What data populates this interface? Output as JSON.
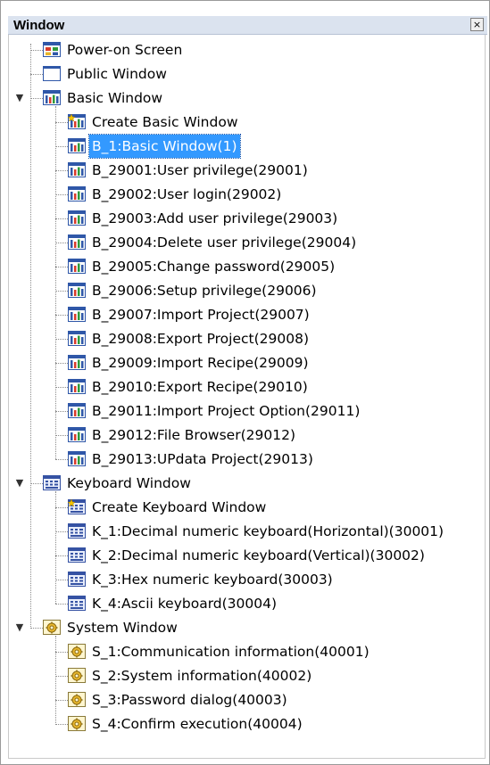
{
  "panel": {
    "title": "Window",
    "close_glyph": "×"
  },
  "tree": {
    "power_on": {
      "label": "Power-on Screen",
      "icon": "power-on-screen-icon"
    },
    "public": {
      "label": "Public Window",
      "icon": "window-icon"
    },
    "basic": {
      "label": "Basic Window",
      "expanded": true,
      "icon": "basic-window-icon",
      "items": [
        {
          "label": "Create Basic Window"
        },
        {
          "label": "B_1:Basic Window(1)",
          "selected": true
        },
        {
          "label": "B_29001:User privilege(29001)"
        },
        {
          "label": "B_29002:User login(29002)"
        },
        {
          "label": "B_29003:Add user privilege(29003)"
        },
        {
          "label": "B_29004:Delete user privilege(29004)"
        },
        {
          "label": "B_29005:Change password(29005)"
        },
        {
          "label": "B_29006:Setup privilege(29006)"
        },
        {
          "label": "B_29007:Import Project(29007)"
        },
        {
          "label": "B_29008:Export Project(29008)"
        },
        {
          "label": "B_29009:Import Recipe(29009)"
        },
        {
          "label": "B_29010:Export Recipe(29010)"
        },
        {
          "label": "B_29011:Import Project Option(29011)"
        },
        {
          "label": "B_29012:File Browser(29012)"
        },
        {
          "label": "B_29013:UPdata Project(29013)"
        }
      ]
    },
    "keyboard": {
      "label": "Keyboard Window",
      "expanded": true,
      "icon": "keyboard-window-icon",
      "items": [
        {
          "label": "Create Keyboard Window"
        },
        {
          "label": "K_1:Decimal numeric keyboard(Horizontal)(30001)"
        },
        {
          "label": "K_2:Decimal numeric keyboard(Vertical)(30002)"
        },
        {
          "label": "K_3:Hex numeric keyboard(30003)"
        },
        {
          "label": "K_4:Ascii keyboard(30004)"
        }
      ]
    },
    "system": {
      "label": "System Window",
      "expanded": true,
      "icon": "system-window-icon",
      "items": [
        {
          "label": "S_1:Communication information(40001)"
        },
        {
          "label": "S_2:System information(40002)"
        },
        {
          "label": "S_3:Password dialog(40003)"
        },
        {
          "label": "S_4:Confirm execution(40004)"
        }
      ]
    }
  }
}
